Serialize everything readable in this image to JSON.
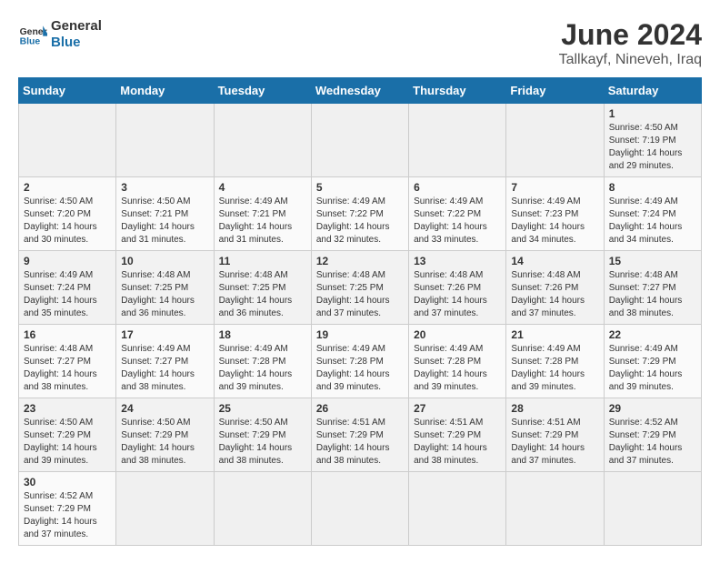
{
  "logo": {
    "text_general": "General",
    "text_blue": "Blue"
  },
  "header": {
    "title": "June 2024",
    "subtitle": "Tallkayf, Nineveh, Iraq"
  },
  "weekdays": [
    "Sunday",
    "Monday",
    "Tuesday",
    "Wednesday",
    "Thursday",
    "Friday",
    "Saturday"
  ],
  "weeks": [
    [
      {
        "day": "",
        "info": ""
      },
      {
        "day": "",
        "info": ""
      },
      {
        "day": "",
        "info": ""
      },
      {
        "day": "",
        "info": ""
      },
      {
        "day": "",
        "info": ""
      },
      {
        "day": "",
        "info": ""
      },
      {
        "day": "1",
        "info": "Sunrise: 4:50 AM\nSunset: 7:19 PM\nDaylight: 14 hours and 29 minutes."
      }
    ],
    [
      {
        "day": "2",
        "info": "Sunrise: 4:50 AM\nSunset: 7:20 PM\nDaylight: 14 hours and 30 minutes."
      },
      {
        "day": "3",
        "info": "Sunrise: 4:50 AM\nSunset: 7:21 PM\nDaylight: 14 hours and 31 minutes."
      },
      {
        "day": "4",
        "info": "Sunrise: 4:49 AM\nSunset: 7:21 PM\nDaylight: 14 hours and 31 minutes."
      },
      {
        "day": "5",
        "info": "Sunrise: 4:49 AM\nSunset: 7:22 PM\nDaylight: 14 hours and 32 minutes."
      },
      {
        "day": "6",
        "info": "Sunrise: 4:49 AM\nSunset: 7:22 PM\nDaylight: 14 hours and 33 minutes."
      },
      {
        "day": "7",
        "info": "Sunrise: 4:49 AM\nSunset: 7:23 PM\nDaylight: 14 hours and 34 minutes."
      },
      {
        "day": "8",
        "info": "Sunrise: 4:49 AM\nSunset: 7:24 PM\nDaylight: 14 hours and 34 minutes."
      }
    ],
    [
      {
        "day": "9",
        "info": "Sunrise: 4:49 AM\nSunset: 7:24 PM\nDaylight: 14 hours and 35 minutes."
      },
      {
        "day": "10",
        "info": "Sunrise: 4:48 AM\nSunset: 7:25 PM\nDaylight: 14 hours and 36 minutes."
      },
      {
        "day": "11",
        "info": "Sunrise: 4:48 AM\nSunset: 7:25 PM\nDaylight: 14 hours and 36 minutes."
      },
      {
        "day": "12",
        "info": "Sunrise: 4:48 AM\nSunset: 7:25 PM\nDaylight: 14 hours and 37 minutes."
      },
      {
        "day": "13",
        "info": "Sunrise: 4:48 AM\nSunset: 7:26 PM\nDaylight: 14 hours and 37 minutes."
      },
      {
        "day": "14",
        "info": "Sunrise: 4:48 AM\nSunset: 7:26 PM\nDaylight: 14 hours and 37 minutes."
      },
      {
        "day": "15",
        "info": "Sunrise: 4:48 AM\nSunset: 7:27 PM\nDaylight: 14 hours and 38 minutes."
      }
    ],
    [
      {
        "day": "16",
        "info": "Sunrise: 4:48 AM\nSunset: 7:27 PM\nDaylight: 14 hours and 38 minutes."
      },
      {
        "day": "17",
        "info": "Sunrise: 4:49 AM\nSunset: 7:27 PM\nDaylight: 14 hours and 38 minutes."
      },
      {
        "day": "18",
        "info": "Sunrise: 4:49 AM\nSunset: 7:28 PM\nDaylight: 14 hours and 39 minutes."
      },
      {
        "day": "19",
        "info": "Sunrise: 4:49 AM\nSunset: 7:28 PM\nDaylight: 14 hours and 39 minutes."
      },
      {
        "day": "20",
        "info": "Sunrise: 4:49 AM\nSunset: 7:28 PM\nDaylight: 14 hours and 39 minutes."
      },
      {
        "day": "21",
        "info": "Sunrise: 4:49 AM\nSunset: 7:28 PM\nDaylight: 14 hours and 39 minutes."
      },
      {
        "day": "22",
        "info": "Sunrise: 4:49 AM\nSunset: 7:29 PM\nDaylight: 14 hours and 39 minutes."
      }
    ],
    [
      {
        "day": "23",
        "info": "Sunrise: 4:50 AM\nSunset: 7:29 PM\nDaylight: 14 hours and 39 minutes."
      },
      {
        "day": "24",
        "info": "Sunrise: 4:50 AM\nSunset: 7:29 PM\nDaylight: 14 hours and 38 minutes."
      },
      {
        "day": "25",
        "info": "Sunrise: 4:50 AM\nSunset: 7:29 PM\nDaylight: 14 hours and 38 minutes."
      },
      {
        "day": "26",
        "info": "Sunrise: 4:51 AM\nSunset: 7:29 PM\nDaylight: 14 hours and 38 minutes."
      },
      {
        "day": "27",
        "info": "Sunrise: 4:51 AM\nSunset: 7:29 PM\nDaylight: 14 hours and 38 minutes."
      },
      {
        "day": "28",
        "info": "Sunrise: 4:51 AM\nSunset: 7:29 PM\nDaylight: 14 hours and 37 minutes."
      },
      {
        "day": "29",
        "info": "Sunrise: 4:52 AM\nSunset: 7:29 PM\nDaylight: 14 hours and 37 minutes."
      }
    ],
    [
      {
        "day": "30",
        "info": "Sunrise: 4:52 AM\nSunset: 7:29 PM\nDaylight: 14 hours and 37 minutes."
      },
      {
        "day": "",
        "info": ""
      },
      {
        "day": "",
        "info": ""
      },
      {
        "day": "",
        "info": ""
      },
      {
        "day": "",
        "info": ""
      },
      {
        "day": "",
        "info": ""
      },
      {
        "day": "",
        "info": ""
      }
    ]
  ]
}
